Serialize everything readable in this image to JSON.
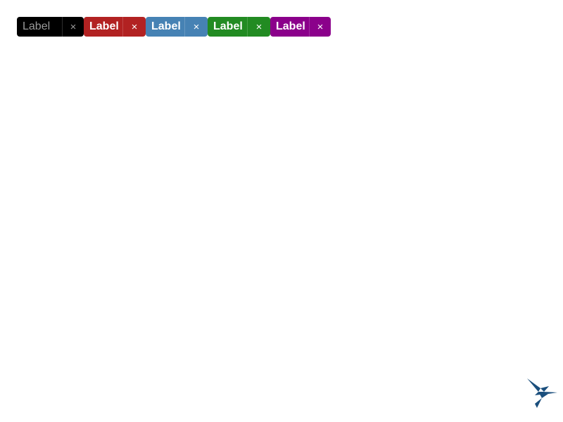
{
  "tags": [
    {
      "label": "Label",
      "remove_glyph": "×",
      "bg": "#000000",
      "text_color": "#9a9a9a",
      "remove_color": "#9a9a9a"
    },
    {
      "label": "Label",
      "remove_glyph": "×",
      "bg": "#b22222",
      "text_color": "#ffffff",
      "remove_color": "#ffffff"
    },
    {
      "label": "Label",
      "remove_glyph": "×",
      "bg": "#4682b4",
      "text_color": "#ffffff",
      "remove_color": "#ffffff"
    },
    {
      "label": "Label",
      "remove_glyph": "×",
      "bg": "#228b22",
      "text_color": "#ffffff",
      "remove_color": "#ffffff"
    },
    {
      "label": "Label",
      "remove_glyph": "×",
      "bg": "#8b008b",
      "text_color": "#ffffff",
      "remove_color": "#ffffff"
    }
  ],
  "logo": {
    "icon": "hummingbird-icon",
    "color": "#1b4f7d"
  }
}
